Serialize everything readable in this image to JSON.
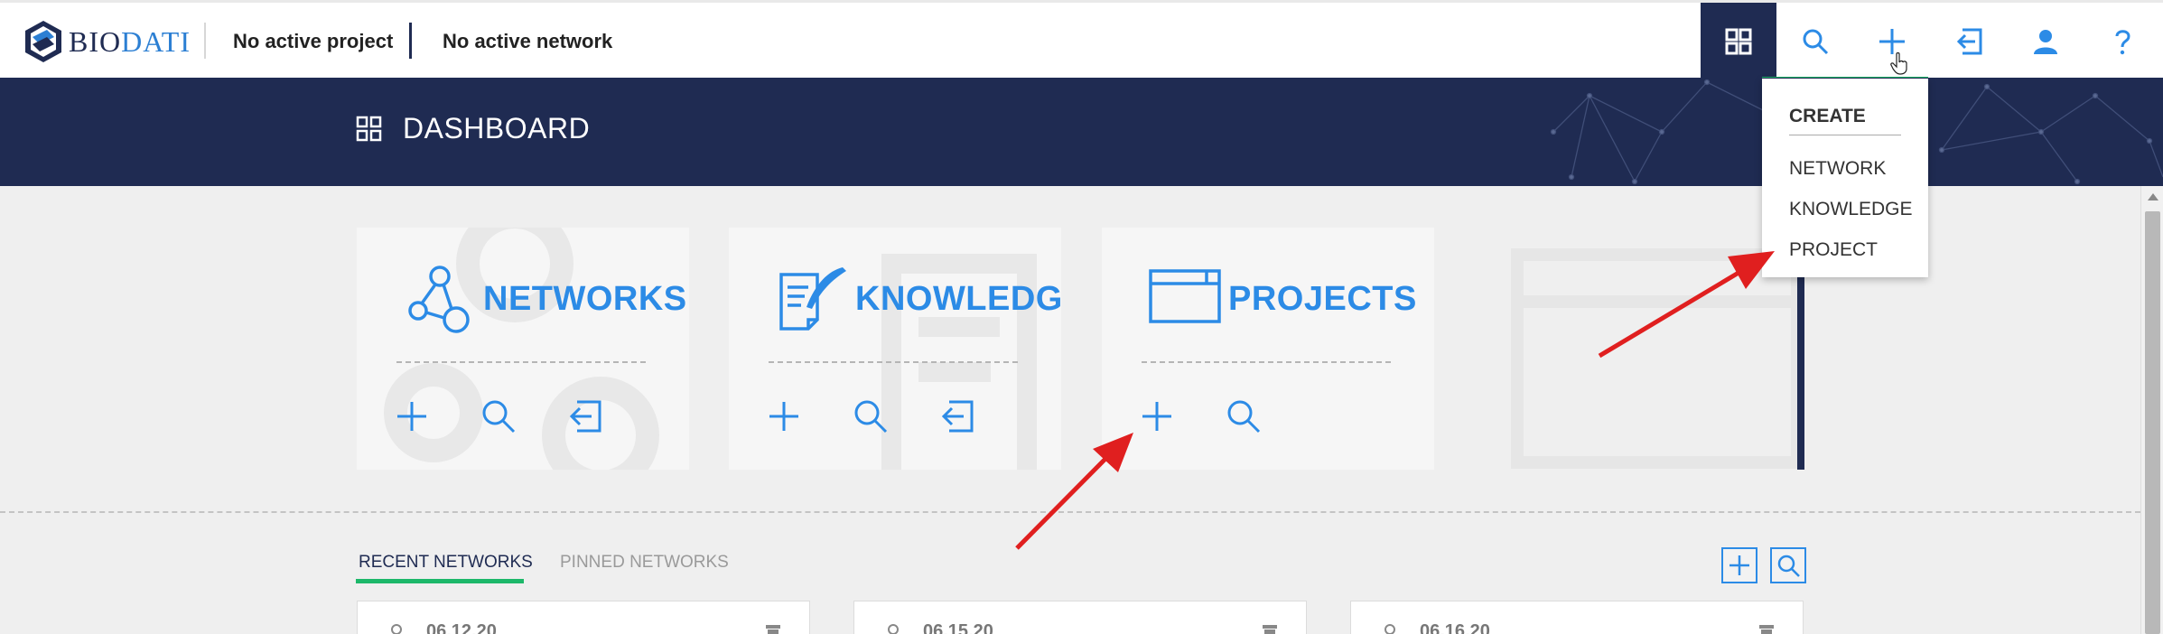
{
  "app": {
    "logo_text_primary": "BIO",
    "logo_text_secondary": "DATI",
    "active_project": "No active project",
    "active_network": "No active network"
  },
  "topnav": {
    "icons": [
      "dashboard-icon",
      "search-icon",
      "plus-icon",
      "import-icon",
      "user-icon",
      "help-icon"
    ]
  },
  "banner": {
    "title": "DASHBOARD"
  },
  "create_menu": {
    "title": "CREATE",
    "items": [
      "NETWORK",
      "KNOWLEDGE",
      "PROJECT"
    ]
  },
  "cards": [
    {
      "title": "NETWORKS",
      "icon": "network-icon",
      "actions": [
        "plus-icon",
        "search-icon",
        "import-icon"
      ]
    },
    {
      "title": "KNOWLEDGE",
      "icon": "document-pen-icon",
      "actions": [
        "plus-icon",
        "search-icon",
        "import-icon"
      ]
    },
    {
      "title": "PROJECTS",
      "icon": "window-icon",
      "actions": [
        "plus-icon",
        "search-icon"
      ]
    }
  ],
  "tabs": [
    {
      "label": "RECENT NETWORKS",
      "active": true
    },
    {
      "label": "PINNED NETWORKS",
      "active": false
    }
  ],
  "recent": [
    {
      "date": "06.12.20"
    },
    {
      "date": "06.15.20"
    },
    {
      "date": "06.16.20"
    }
  ],
  "colors": {
    "navy": "#1f2b52",
    "accent_blue": "#2c8be6",
    "accent_green": "#1db86a",
    "arrow_red": "#e01f1f"
  }
}
